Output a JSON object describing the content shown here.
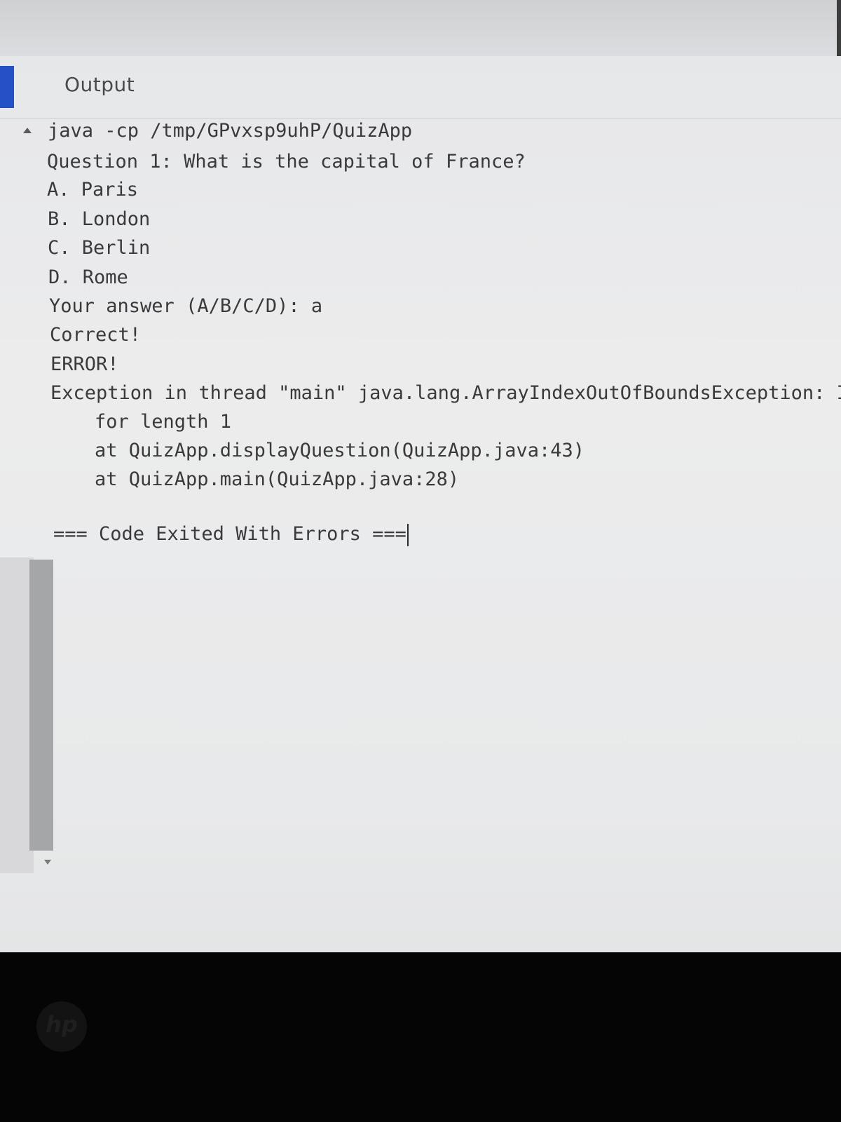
{
  "panel": {
    "title": "Output"
  },
  "console": {
    "lines": [
      "java -cp /tmp/GPvxsp9uhP/QuizApp",
      "Question 1: What is the capital of France?",
      "A. Paris",
      "B. London",
      "C. Berlin",
      "D. Rome",
      "Your answer (A/B/C/D): a",
      "Correct!",
      "ERROR!",
      "Exception in thread \"main\" java.lang.ArrayIndexOutOfBoundsException: Ind",
      "for length 1",
      "at QuizApp.displayQuestion(QuizApp.java:43)",
      "at QuizApp.main(QuizApp.java:28)",
      "=== Code Exited With Errors ==="
    ]
  },
  "icons": {
    "collapse": "caret-up-icon",
    "scroll_down": "caret-down-icon",
    "brand": "hp-logo"
  },
  "brand": {
    "logo_text": "hp"
  },
  "colors": {
    "accent": "#2451c6",
    "text": "#3a3a3c",
    "background": "#ececed",
    "bezel": "#050505"
  }
}
